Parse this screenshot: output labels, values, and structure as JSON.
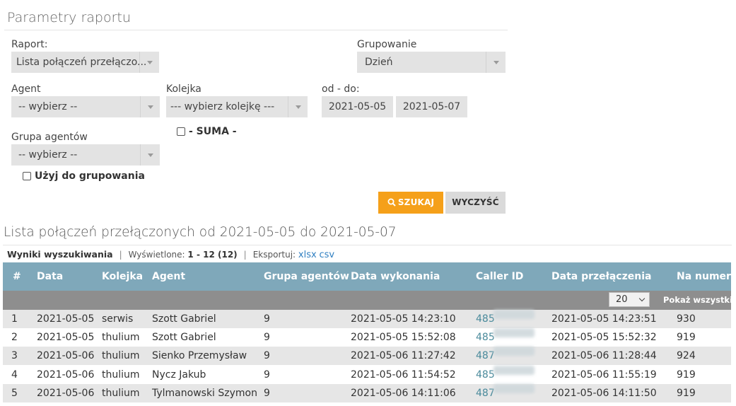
{
  "panel": {
    "title": "Parametry raportu"
  },
  "form": {
    "report_label": "Raport:",
    "report_value": "Lista połączeń przełączo...",
    "grouping_label": "Grupowanie",
    "grouping_value": "Dzień",
    "agent_label": "Agent",
    "agent_value": "-- wybierz --",
    "queue_label": "Kolejka",
    "queue_value": "--- wybierz kolejkę ---",
    "range_label": "od - do:",
    "date_from": "2021-05-05",
    "date_to": "2021-05-07",
    "suma_label": "- SUMA -",
    "agent_group_label": "Grupa agentów",
    "agent_group_value": "-- wybierz --",
    "use_grouping_label": "Użyj do grupowania",
    "search_button": "SZUKAJ",
    "clear_button": "WYCZYŚĆ"
  },
  "results": {
    "title": "Lista połączeń przełączonych od 2021-05-05 do 2021-05-07",
    "search_results": "Wyniki wyszukiwania",
    "displayed_label": "Wyświetlone:",
    "displayed_value": "1 - 12 (12)",
    "export_label": "Eksportuj:",
    "export_xlsx": "xlsx",
    "export_csv": "csv",
    "page_size": "20",
    "show_all": "Pokaż wszystkie",
    "columns": [
      "#",
      "Data",
      "Kolejka",
      "Agent",
      "Grupa agentów",
      "Data wykonania",
      "Caller ID",
      "Data przełączenia",
      "Na numer"
    ],
    "rows": [
      [
        "1",
        "2021-05-05",
        "serwis",
        "Szott Gabriel",
        "9",
        "2021-05-05 14:23:10",
        "485",
        "2021-05-05 14:23:51",
        "930"
      ],
      [
        "2",
        "2021-05-05",
        "thulium",
        "Szott Gabriel",
        "9",
        "2021-05-05 15:52:08",
        "485",
        "2021-05-05 15:52:32",
        "919"
      ],
      [
        "3",
        "2021-05-06",
        "thulium",
        "Sienko Przemysław",
        "9",
        "2021-05-06 11:27:42",
        "487",
        "2021-05-06 11:28:44",
        "924"
      ],
      [
        "4",
        "2021-05-06",
        "thulium",
        "Nycz Jakub",
        "9",
        "2021-05-06 11:54:52",
        "485",
        "2021-05-06 11:55:19",
        "919"
      ],
      [
        "5",
        "2021-05-06",
        "thulium",
        "Tylmanowski Szymon",
        "9",
        "2021-05-06 14:11:06",
        "487",
        "2021-05-06 14:11:50",
        "919"
      ]
    ]
  },
  "colors": {
    "accent": "#f5a01a",
    "table_header": "#7fa8ba",
    "pager_bar": "#8e8e8e",
    "link": "#2f7fc1"
  }
}
